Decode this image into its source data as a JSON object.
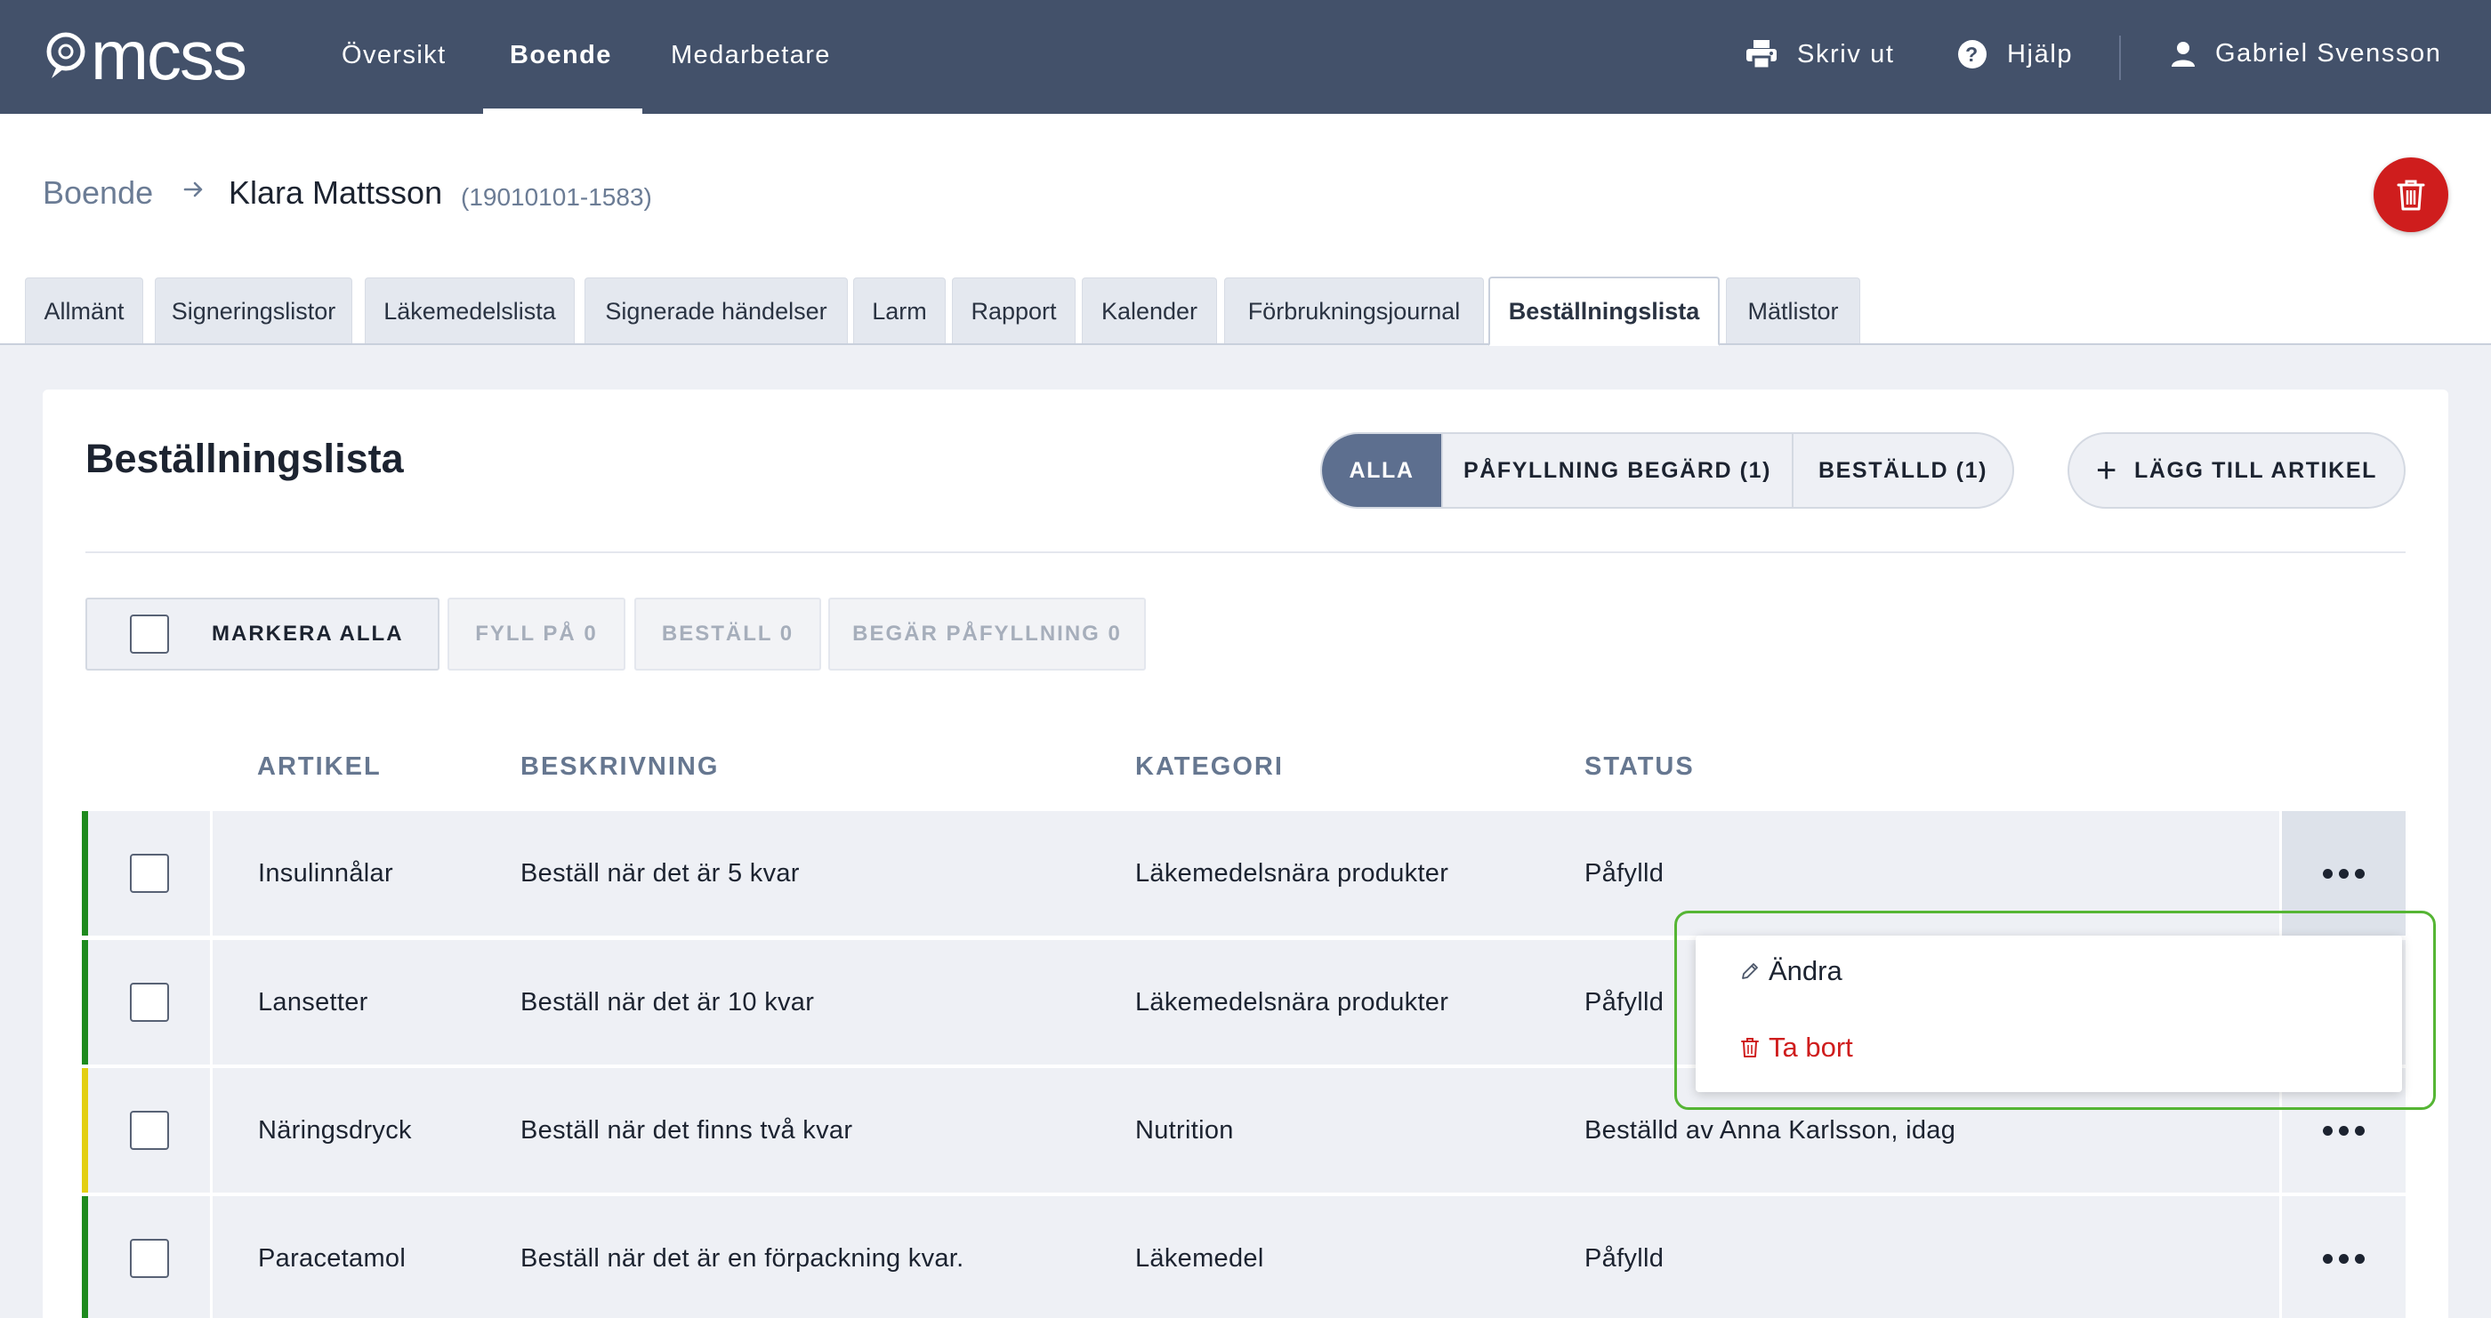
{
  "app": {
    "logo_text": "mcss"
  },
  "nav": {
    "items": [
      {
        "label": "Översikt"
      },
      {
        "label": "Boende"
      },
      {
        "label": "Medarbetare"
      }
    ],
    "active": "Boende"
  },
  "top_actions": {
    "print_label": "Skriv ut",
    "help_label": "Hjälp",
    "user_name": "Gabriel Svensson"
  },
  "breadcrumb": {
    "root": "Boende",
    "name": "Klara Mattsson",
    "personal_number": "(19010101-1583)"
  },
  "tabs": [
    {
      "label": "Allmänt"
    },
    {
      "label": "Signeringslistor"
    },
    {
      "label": "Läkemedelslista"
    },
    {
      "label": "Signerade händelser"
    },
    {
      "label": "Larm"
    },
    {
      "label": "Rapport"
    },
    {
      "label": "Kalender"
    },
    {
      "label": "Förbrukningsjournal"
    },
    {
      "label": "Beställningslista"
    },
    {
      "label": "Mätlistor"
    }
  ],
  "active_tab": "Beställningslista",
  "page": {
    "title": "Beställningslista",
    "filters": [
      {
        "label": "ALLA"
      },
      {
        "label": "PÅFYLLNING BEGÄRD (1)"
      },
      {
        "label": "BESTÄLLD (1)"
      }
    ],
    "active_filter": "ALLA",
    "add_label": "LÄGG TILL ARTIKEL"
  },
  "bulk_actions": {
    "select_all": "MARKERA ALLA",
    "refill": "FYLL PÅ 0",
    "order": "BESTÄLL 0",
    "request_refill": "BEGÄR PÅFYLLNING 0"
  },
  "table": {
    "columns": [
      "ARTIKEL",
      "BESKRIVNING",
      "KATEGORI",
      "STATUS"
    ],
    "rows": [
      {
        "article": "Insulinnålar",
        "description": "Beställ när det är 5 kvar",
        "category": "Läkemedelsnära produkter",
        "status": "Påfylld",
        "status_color": "#1e8a1e"
      },
      {
        "article": "Lansetter",
        "description": "Beställ när det är 10 kvar",
        "category": "Läkemedelsnära produkter",
        "status": "Påfylld",
        "status_color": "#1e8a1e"
      },
      {
        "article": "Näringsdryck",
        "description": "Beställ när det finns två kvar",
        "category": "Nutrition",
        "status": "Beställd av Anna Karlsson, idag",
        "status_color": "#e3cf12"
      },
      {
        "article": "Paracetamol",
        "description": "Beställ när det är en förpackning kvar.",
        "category": "Läkemedel",
        "status": "Påfylld",
        "status_color": "#1e8a1e"
      }
    ]
  },
  "row_menu": {
    "edit_label": "Ändra",
    "delete_label": "Ta bort"
  },
  "colors": {
    "topbar": "#43516a",
    "accent": "#5d6f8f",
    "danger": "#cf1d1d",
    "highlight_outline": "#55b534"
  }
}
